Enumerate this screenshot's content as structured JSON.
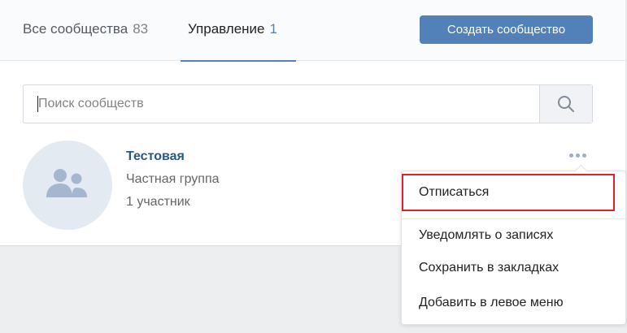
{
  "tabs": [
    {
      "label": "Все сообщества",
      "count": "83"
    },
    {
      "label": "Управление",
      "count": "1"
    }
  ],
  "create_button": "Создать сообщество",
  "search": {
    "placeholder": "Поиск сообществ",
    "value": ""
  },
  "group": {
    "name": "Тестовая",
    "type": "Частная группа",
    "members": "1 участник"
  },
  "menu": {
    "items": [
      {
        "label": "Отписаться"
      },
      {
        "label": "Уведомлять о записях"
      },
      {
        "label": "Сохранить в закладках"
      },
      {
        "label": "Добавить в левое меню"
      }
    ]
  },
  "colors": {
    "accent": "#5181b8",
    "link": "#2a5885",
    "highlight": "#e0202f"
  },
  "icons": {
    "search": "search-icon",
    "avatar": "users-icon",
    "more": "more-dots-icon"
  }
}
